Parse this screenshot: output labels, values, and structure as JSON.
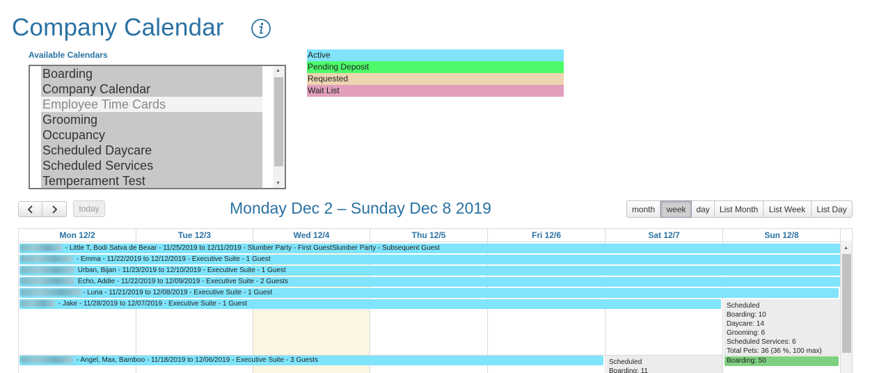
{
  "page": {
    "title": "Company Calendar",
    "info_icon": "info-circle-icon"
  },
  "available_calendars": {
    "label": "Available Calendars",
    "options": [
      {
        "label": "Boarding",
        "selected": true
      },
      {
        "label": "Company Calendar",
        "selected": true
      },
      {
        "label": "Employee Time Cards",
        "selected": false
      },
      {
        "label": "Grooming",
        "selected": true
      },
      {
        "label": "Occupancy",
        "selected": true
      },
      {
        "label": "Scheduled Daycare",
        "selected": true
      },
      {
        "label": "Scheduled Services",
        "selected": true
      },
      {
        "label": "Temperament Test",
        "selected": true
      }
    ]
  },
  "legend": [
    {
      "label": "Active",
      "color": "#7fe4fc"
    },
    {
      "label": "Pending Deposit",
      "color": "#4dfb6a"
    },
    {
      "label": "Requested",
      "color": "#edd5b1"
    },
    {
      "label": "Wait List",
      "color": "#e19fbb"
    }
  ],
  "toolbar": {
    "prev_icon": "chevron-left-icon",
    "next_icon": "chevron-right-icon",
    "today_label": "today",
    "range_title": "Monday Dec 2 – Sunday Dec 8 2019",
    "views": [
      "month",
      "week",
      "day",
      "List Month",
      "List Week",
      "List Day"
    ],
    "active_view": "week"
  },
  "days": [
    "Mon 12/2",
    "Tue 12/3",
    "Wed 12/4",
    "Thu 12/5",
    "Fri 12/6",
    "Sat 12/7",
    "Sun 12/8"
  ],
  "today_index": 2,
  "events": [
    {
      "text": " - Little T, Bodi Satva de Bexar - 11/25/2019 to 12/11/2019 - Slumber Party - First GuestSlumber Party - Subsequent Guest"
    },
    {
      "text": " - Emma - 11/22/2019 to 12/12/2019 - Executive Suite - 1 Guest"
    },
    {
      "text": " Urban, Bijan - 11/23/2019 to 12/10/2019 - Executive Suite - 1 Guest"
    },
    {
      "text": " Echo, Addie - 11/22/2019 to 12/09/2019 - Executive Suite - 2 Guests"
    },
    {
      "text": "- Luna - 11/21/2019 to 12/08/2019 - Executive Suite - 1 Guest"
    },
    {
      "text": " - Jake - 11/28/2019 to 12/07/2019 - Executive Suite - 1 Guest"
    },
    {
      "text": " - Angel, Max, Bamboo - 11/18/2019 to 12/06/2019 - Executive Suite - 3 Guests"
    }
  ],
  "sunday_summary": [
    "Scheduled",
    "Boarding: 10",
    "Daycare: 14",
    "Grooming: 6",
    "Scheduled Services: 6",
    "Total Pets: 36 (36 %, 100 max)"
  ],
  "sunday_boarding": "Boarding: 50",
  "saturday_summary": [
    "Scheduled",
    "Boarding: 11"
  ]
}
